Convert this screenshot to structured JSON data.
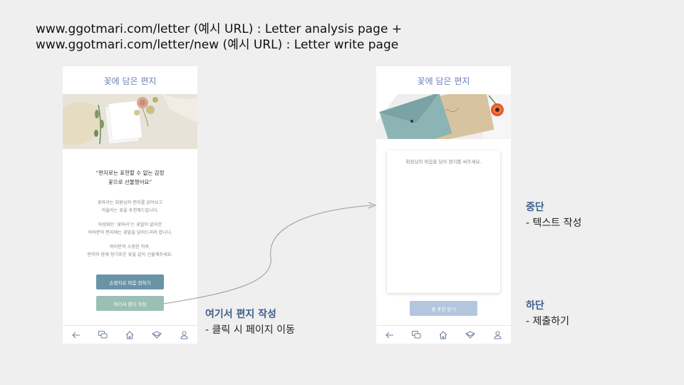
{
  "header": {
    "line1": "www.ggotmari.com/letter (예시 URL) : Letter analysis page +",
    "line2": "www.ggotmari.com/letter/new (예시 URL) : Letter write page"
  },
  "left_screen": {
    "title": "꽃에 담은 편지",
    "quote_line1": "“편지로는 표현할 수 없는 감정",
    "quote_line2": "꽃으로 선물했어요”",
    "desc1_line1": "꽃마리는 회원님의 편지를 읽어보고",
    "desc1_line2": "어울리는 꽃을 추천해드립니다.",
    "desc2_line1": "아생화인 ‘꽃마리’는 꽃말이 없지만",
    "desc2_line2": "여러분의 편지에는 꽃말을 담아드리려 합니다.",
    "desc3_line1": "여러분의 소중한 하루,",
    "desc3_line2": "편지와 함께 향기로운 꽃을 같이 선물해주세요.",
    "btn_handwrite": "손편지로 마음 전하기",
    "btn_write_here": "여기서 편지 작성"
  },
  "right_screen": {
    "title": "꽃에 담은 편지",
    "placeholder": "회원님의 마음을 담아 편지를 써주세요.",
    "submit": "꽃 추천 받기"
  },
  "nav_icons": [
    "back-arrow-icon",
    "chat-bubbles-icon",
    "home-icon",
    "letter-icon",
    "user-icon"
  ],
  "annotations": {
    "write_here_title": "여기서 편지 작성",
    "write_here_desc": "- 클릭 시 페이지 이동",
    "middle_title": "중단",
    "middle_desc": "- 텍스트 작성",
    "bottom_title": "하단",
    "bottom_desc": "- 제출하기"
  },
  "colors": {
    "title_blue": "#6b83b8",
    "btn_handwrite": "#6b93a8",
    "btn_write_here": "#9cbfb5",
    "btn_submit": "#b3c6dd",
    "annotation_blue": "#3f5e8e"
  }
}
